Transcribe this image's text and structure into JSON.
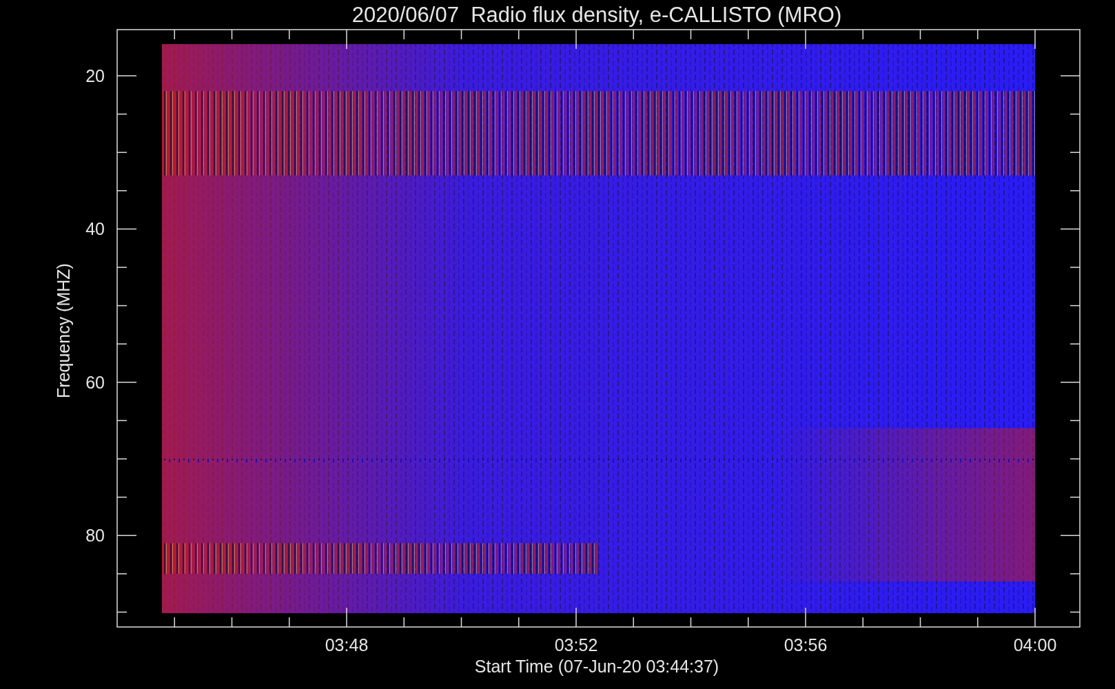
{
  "plot": {
    "title": "2020/06/07  Radio flux density, e-CALLISTO (MRO)",
    "ylabel": "Frequency (MHZ)",
    "xlabel": "Start Time (07-Jun-20 03:44:37)",
    "y_tick_labels": [
      "20",
      "40",
      "60",
      "80"
    ],
    "x_tick_labels": [
      "03:48",
      "03:52",
      "03:56",
      "04:00"
    ]
  }
}
